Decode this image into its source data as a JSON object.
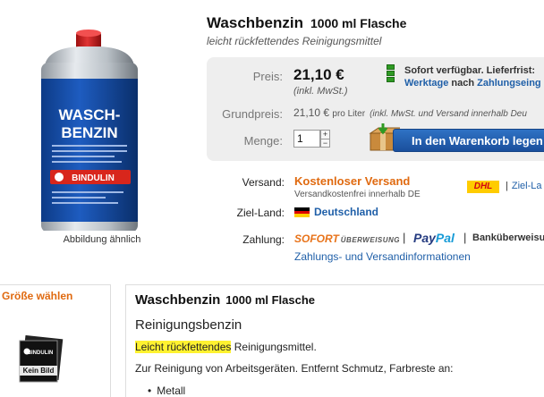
{
  "product": {
    "title": "Waschbenzin",
    "size": "1000 ml Flasche",
    "subtitle": "leicht rückfettendes Reinigungsmittel",
    "image_caption": "Abbildung ähnlich",
    "can_label_line1": "WASCH-",
    "can_label_line2": "BENZIN",
    "can_brand": "BINDULIN"
  },
  "price_box": {
    "price_label": "Preis:",
    "price": "21,10 €",
    "price_note": "(inkl. MwSt.)",
    "stock_line1": "Sofort verfügbar. Lieferfrist:",
    "stock_days": "Werktage",
    "stock_after": "nach",
    "stock_link": "Zahlungseing",
    "unit_price_label": "Grundpreis:",
    "unit_price": "21,10 €",
    "unit_price_per": "pro Liter",
    "unit_price_note": "(inkl. MwSt. und Versand innerhalb Deu",
    "quantity_label": "Menge:",
    "quantity": "1",
    "cart_button": "In den Warenkorb legen"
  },
  "shipping": {
    "label": "Versand:",
    "value": "Kostenloser Versand",
    "sub": "Versandkostenfrei innerhalb DE",
    "carrier": "DHL",
    "target_link": "Ziel-La",
    "country_label": "Ziel-Land:",
    "country": "Deutschland",
    "payment_label": "Zahlung:",
    "sofort": "SOFORT",
    "sofort_small": "ÜBERWEISUNG",
    "paypal_1": "Pay",
    "paypal_2": "Pal",
    "bank": "Banküberweisu",
    "info_link": "Zahlungs- und Versandinformationen"
  },
  "size_panel": {
    "title": "Größe wählen",
    "thumb_brand": "BINDULIN",
    "thumb_text": "Kein Bild"
  },
  "description": {
    "title": "Waschbenzin",
    "size": "1000 ml Flasche",
    "subtitle": "Reinigungsbenzin",
    "line1_highlight": "Leicht rückfettendes",
    "line1_rest": " Reinigungsmittel.",
    "line2": "Zur Reinigung von Arbeitsgeräten. Entfernt Schmutz, Farbreste an:",
    "bullets": [
      "Metall"
    ]
  },
  "colors": {
    "accent_orange": "#e06a10",
    "link_blue": "#1f5fa8",
    "cart_blue": "#1a4f9c",
    "stock_green": "#2e9a23",
    "highlight": "#fff230"
  }
}
